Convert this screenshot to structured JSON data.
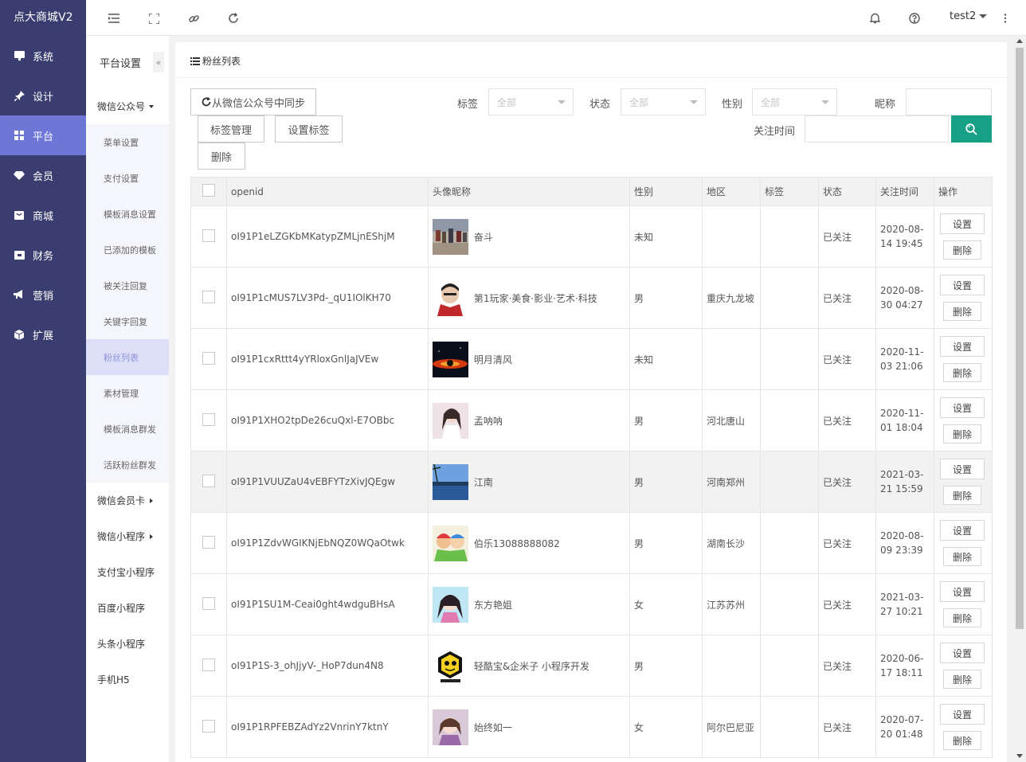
{
  "app": {
    "brand": "点大商城V2"
  },
  "left_nav": [
    {
      "label": "系统",
      "icon": "monitor-icon"
    },
    {
      "label": "设计",
      "icon": "pin-icon"
    },
    {
      "label": "平台",
      "icon": "grid-icon",
      "active": true
    },
    {
      "label": "会员",
      "icon": "diamond-icon"
    },
    {
      "label": "商城",
      "icon": "store-icon"
    },
    {
      "label": "财务",
      "icon": "wallet-icon"
    },
    {
      "label": "营销",
      "icon": "megaphone-icon"
    },
    {
      "label": "扩展",
      "icon": "cube-icon"
    }
  ],
  "header": {
    "user": "test2"
  },
  "sub_nav": {
    "title": "平台设置",
    "collapse": "«",
    "group_wechat_mp": "微信公众号",
    "items": [
      "菜单设置",
      "支付设置",
      "模板消息设置",
      "已添加的模板",
      "被关注回复",
      "关键字回复",
      "粉丝列表",
      "素材管理",
      "模板消息群发",
      "活跃粉丝群发"
    ],
    "active_index": 6,
    "group_member_card": "微信会员卡",
    "group_mini": "微信小程序",
    "alipay": "支付宝小程序",
    "baidu": "百度小程序",
    "toutiao": "头条小程序",
    "h5": "手机H5"
  },
  "page": {
    "title": "粉丝列表",
    "sync_btn": "从微信公众号中同步",
    "tag_manage_btn": "标签管理",
    "set_tag_btn": "设置标签",
    "delete_btn": "删除",
    "filters": {
      "tag_label": "标签",
      "tag_value": "全部",
      "status_label": "状态",
      "status_value": "全部",
      "gender_label": "性别",
      "gender_value": "全部",
      "nickname_label": "昵称",
      "follow_time_label": "关注时间"
    }
  },
  "table": {
    "columns": [
      "openid",
      "头像昵称",
      "性别",
      "地区",
      "标签",
      "状态",
      "关注时间",
      "操作"
    ],
    "set_label": "设置",
    "del_label": "删除",
    "rows": [
      {
        "openid": "oI91P1eLZGKbMKatypZMLjnEShjM",
        "nickname": "奋斗",
        "gender": "未知",
        "region": "",
        "tag": "",
        "status": "已关注",
        "time": "2020-08-14 19:45"
      },
      {
        "openid": "oI91P1cMUS7LV3Pd-_qU1IOlKH70",
        "nickname": "第1玩家·美食·影业·艺术·科技",
        "gender": "男",
        "region": "重庆九龙坡",
        "tag": "",
        "status": "已关注",
        "time": "2020-08-30 04:27"
      },
      {
        "openid": "oI91P1cxRttt4yYRloxGnlJaJVEw",
        "nickname": "明月清风",
        "gender": "未知",
        "region": "",
        "tag": "",
        "status": "已关注",
        "time": "2020-11-03 21:06"
      },
      {
        "openid": "oI91P1XHO2tpDe26cuQxl-E7OBbc",
        "nickname": "孟呐呐",
        "gender": "男",
        "region": "河北唐山",
        "tag": "",
        "status": "已关注",
        "time": "2020-11-01 18:04"
      },
      {
        "openid": "oI91P1VUUZaU4vEBFYTzXivJQEgw",
        "nickname": "江南",
        "gender": "男",
        "region": "河南郑州",
        "tag": "",
        "status": "已关注",
        "time": "2021-03-21 15:59"
      },
      {
        "openid": "oI91P1ZdvWGIKNjEbNQZ0WQaOtwk",
        "nickname": "伯乐13088888082",
        "gender": "男",
        "region": "湖南长沙",
        "tag": "",
        "status": "已关注",
        "time": "2020-08-09 23:39"
      },
      {
        "openid": "oI91P1SU1M-Ceai0ght4wdguBHsA",
        "nickname": "东方艳姐",
        "gender": "女",
        "region": "江苏苏州",
        "tag": "",
        "status": "已关注",
        "time": "2021-03-27 10:21"
      },
      {
        "openid": "oI91P1S-3_ohJjyV-_HoP7dun4N8",
        "nickname": "轻酷宝&企米子 小程序开发",
        "gender": "男",
        "region": "",
        "tag": "",
        "status": "已关注",
        "time": "2020-06-17 18:11"
      },
      {
        "openid": "oI91P1RPFEBZAdYz2VnrinY7ktnY",
        "nickname": "始终如一",
        "gender": "女",
        "region": "阿尔巴尼亚",
        "tag": "",
        "status": "已关注",
        "time": "2020-07-20 01:48"
      }
    ]
  },
  "colors": {
    "nav_bg": "#393d70",
    "nav_active": "#6e76d6",
    "primary": "#16a085",
    "submenu_active_bg": "#dcdff7",
    "submenu_active_text": "#8d93db"
  }
}
